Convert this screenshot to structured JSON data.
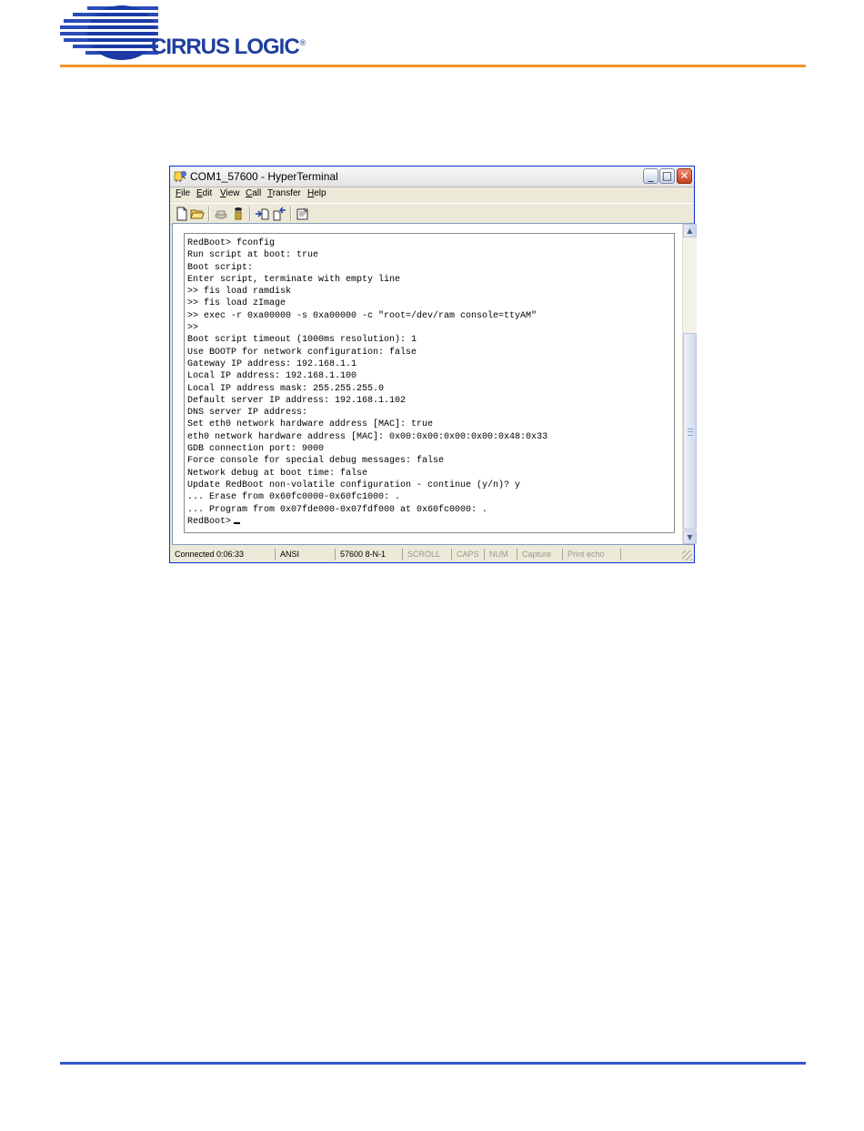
{
  "brand": {
    "logo_text": "CIRRUS LOGIC",
    "registered_mark": "®",
    "colors": {
      "logo_blue": "#1f3f9e",
      "top_rule": "#f0952a",
      "bottom_rule": "#3356cc"
    }
  },
  "window": {
    "title": "COM1_57600 - HyperTerminal",
    "app_icon": "hyperterminal-icon",
    "controls": {
      "minimize": "_",
      "maximize": "□",
      "close": "✕"
    },
    "menu": [
      {
        "mnemonic": "F",
        "rest": "ile"
      },
      {
        "mnemonic": "E",
        "rest": "dit"
      },
      {
        "mnemonic": "V",
        "rest": "iew"
      },
      {
        "mnemonic": "C",
        "rest": "all"
      },
      {
        "mnemonic": "T",
        "rest": "ransfer"
      },
      {
        "mnemonic": "H",
        "rest": "elp"
      }
    ],
    "toolbar_icons": [
      "new-icon",
      "open-icon",
      "disconnect-icon",
      "dial-icon",
      "send-file-icon",
      "receive-file-icon",
      "properties-icon"
    ]
  },
  "terminal": {
    "lines": [
      "RedBoot> fconfig",
      "Run script at boot: true",
      "Boot script:",
      "Enter script, terminate with empty line",
      ">> fis load ramdisk",
      ">> fis load zImage",
      ">> exec -r 0xa00000 -s 0xa00000 -c \"root=/dev/ram console=ttyAM\"",
      ">>",
      "Boot script timeout (1000ms resolution): 1",
      "Use BOOTP for network configuration: false",
      "Gateway IP address: 192.168.1.1",
      "Local IP address: 192.168.1.100",
      "Local IP address mask: 255.255.255.0",
      "Default server IP address: 192.168.1.102",
      "DNS server IP address:",
      "Set eth0 network hardware address [MAC]: true",
      "eth0 network hardware address [MAC]: 0x00:0x00:0x00:0x00:0x48:0x33",
      "GDB connection port: 9000",
      "Force console for special debug messages: false",
      "Network debug at boot time: false",
      "Update RedBoot non-volatile configuration - continue (y/n)? y",
      "... Erase from 0x60fc0000-0x60fc1000: .",
      "... Program from 0x07fde000-0x07fdf000 at 0x60fc0000: ."
    ],
    "prompt": "RedBoot>"
  },
  "status": {
    "connected": "Connected 0:06:33",
    "emulation": "ANSI",
    "port_settings": "57600 8-N-1",
    "scroll": "SCROLL",
    "caps": "CAPS",
    "num": "NUM",
    "capture": "Capture",
    "print_echo": "Print echo"
  }
}
